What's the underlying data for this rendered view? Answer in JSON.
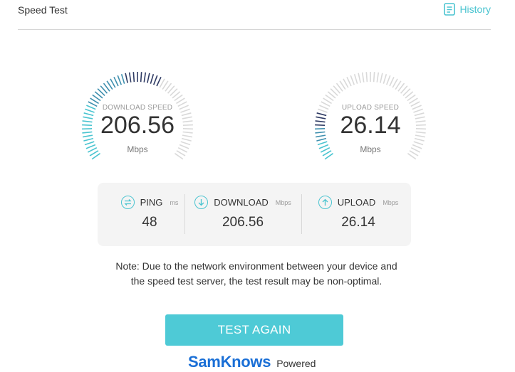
{
  "header": {
    "title": "Speed Test",
    "history_label": "History"
  },
  "colors": {
    "accent": "#4ac4d0",
    "dark_tick": "#2e3a63",
    "button": "#4ecad6",
    "brand": "#1a6fd6"
  },
  "download_gauge": {
    "label": "DOWNLOAD SPEED",
    "value": "206.56",
    "unit": "Mbps",
    "fill_fraction": 0.6
  },
  "upload_gauge": {
    "label": "UPLOAD SPEED",
    "value": "26.14",
    "unit": "Mbps",
    "fill_fraction": 0.2
  },
  "stats": {
    "ping": {
      "label": "PING",
      "unit": "ms",
      "value": "48"
    },
    "download": {
      "label": "DOWNLOAD",
      "unit": "Mbps",
      "value": "206.56"
    },
    "upload": {
      "label": "UPLOAD",
      "unit": "Mbps",
      "value": "26.14"
    }
  },
  "note": {
    "line1": "Note: Due to the network environment between your device and",
    "line2": "the speed test server, the test result may be non-optimal."
  },
  "test_again_label": "TEST AGAIN",
  "footer": {
    "brand": "SamKnows",
    "powered": "Powered"
  }
}
